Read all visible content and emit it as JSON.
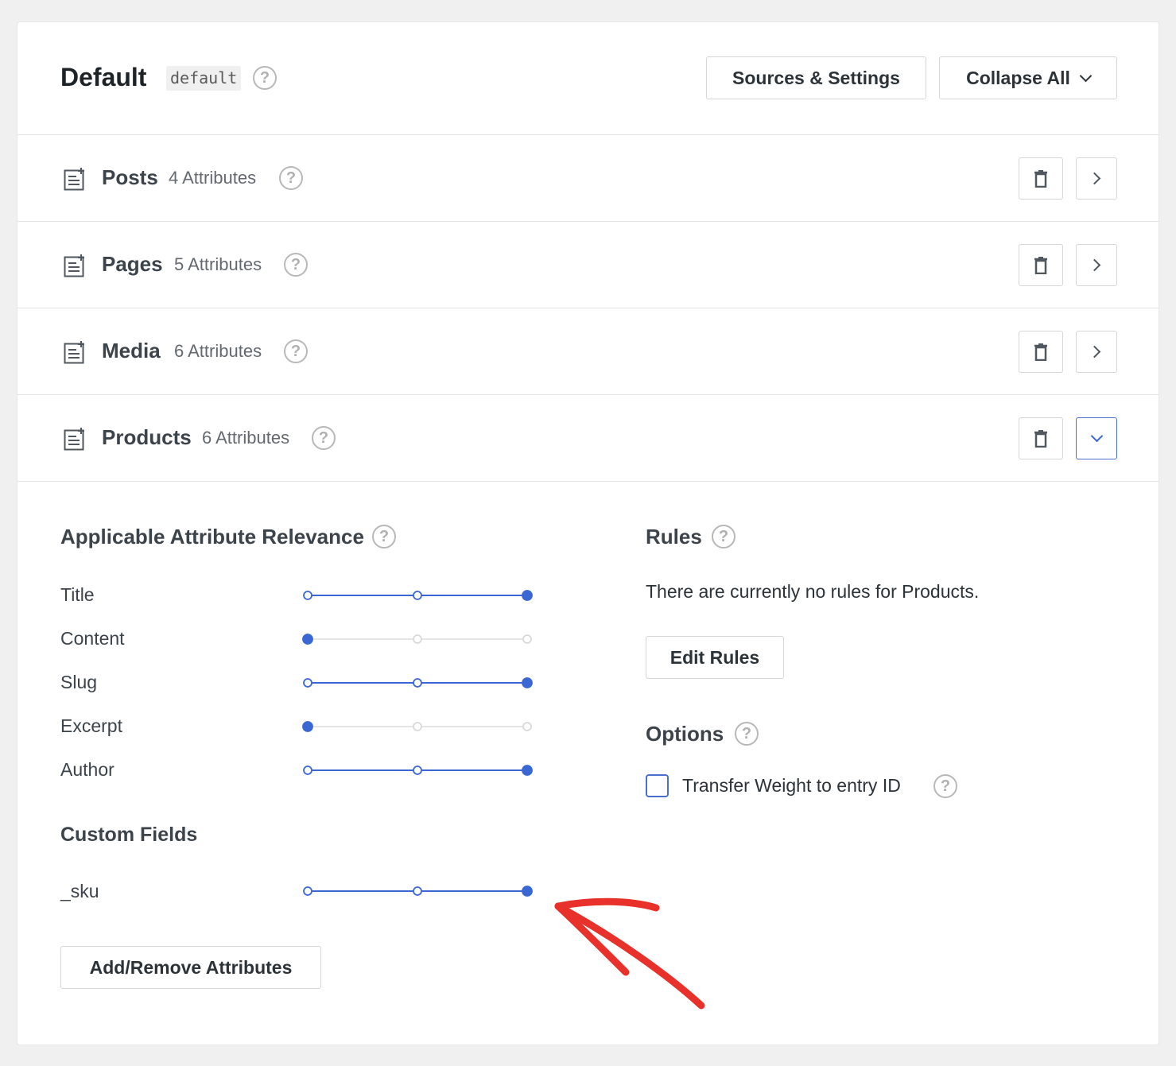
{
  "engine": {
    "title": "Default",
    "slug": "default"
  },
  "header_buttons": {
    "sources_settings": "Sources & Settings",
    "collapse_all": "Collapse All"
  },
  "sources": [
    {
      "name": "Posts",
      "count": "4 Attributes",
      "expanded": false
    },
    {
      "name": "Pages",
      "count": "5 Attributes",
      "expanded": false
    },
    {
      "name": "Media",
      "count": "6 Attributes",
      "expanded": false
    },
    {
      "name": "Products",
      "count": "6 Attributes",
      "expanded": true
    }
  ],
  "relevance": {
    "heading": "Applicable Attribute Relevance",
    "attributes": [
      {
        "label": "Title",
        "level": 3
      },
      {
        "label": "Content",
        "level": 1
      },
      {
        "label": "Slug",
        "level": 3
      },
      {
        "label": "Excerpt",
        "level": 1
      },
      {
        "label": "Author",
        "level": 3
      }
    ],
    "custom_fields_heading": "Custom Fields",
    "custom_fields": [
      {
        "label": "_sku",
        "level": 3
      }
    ],
    "add_remove_button": "Add/Remove Attributes"
  },
  "rules": {
    "heading": "Rules",
    "empty_text": "There are currently no rules for Products.",
    "edit_button": "Edit Rules"
  },
  "options": {
    "heading": "Options",
    "transfer_weight_label": "Transfer Weight to entry ID",
    "transfer_weight_checked": false
  },
  "colors": {
    "accent": "#3b67d4",
    "annotation_arrow": "#e8312a"
  },
  "help_glyph": "?"
}
